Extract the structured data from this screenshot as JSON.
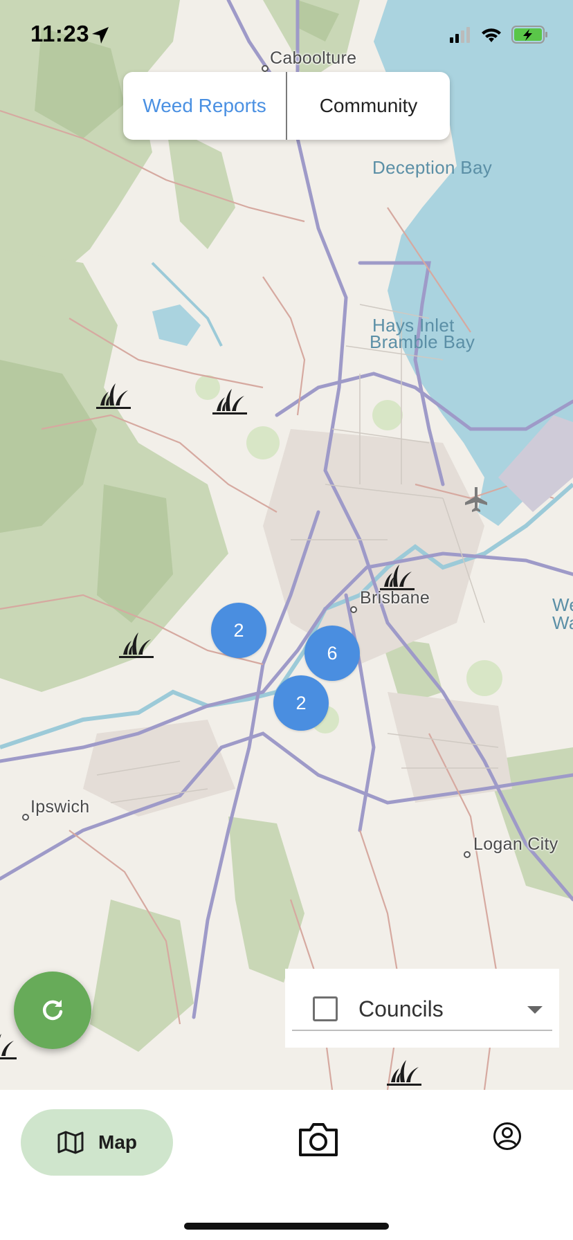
{
  "status_bar": {
    "time": "11:23"
  },
  "segmented_control": {
    "tabs": [
      {
        "label": "Weed Reports",
        "active": true
      },
      {
        "label": "Community",
        "active": false
      }
    ]
  },
  "map": {
    "place_labels": {
      "caboolture": "Caboolture",
      "deception_bay": "Deception Bay",
      "hays_inlet": "Hays Inlet",
      "bramble_bay": "Bramble Bay",
      "brisbane": "Brisbane",
      "ipswich": "Ipswich",
      "logan_city": "Logan City",
      "we": "We",
      "wat": "Wat"
    },
    "clusters": [
      {
        "id": "a",
        "count": "2"
      },
      {
        "id": "b",
        "count": "6"
      },
      {
        "id": "c",
        "count": "2"
      }
    ],
    "colors": {
      "cluster": "#4a8ee0",
      "water": "#aad3df",
      "accent_green": "#67ab59"
    }
  },
  "fab": {
    "icon": "refresh-icon"
  },
  "councils": {
    "label": "Councils",
    "checked": false
  },
  "bottom_nav": {
    "map_label": "Map",
    "icons": [
      "map-icon",
      "camera-icon",
      "profile-icon"
    ]
  }
}
